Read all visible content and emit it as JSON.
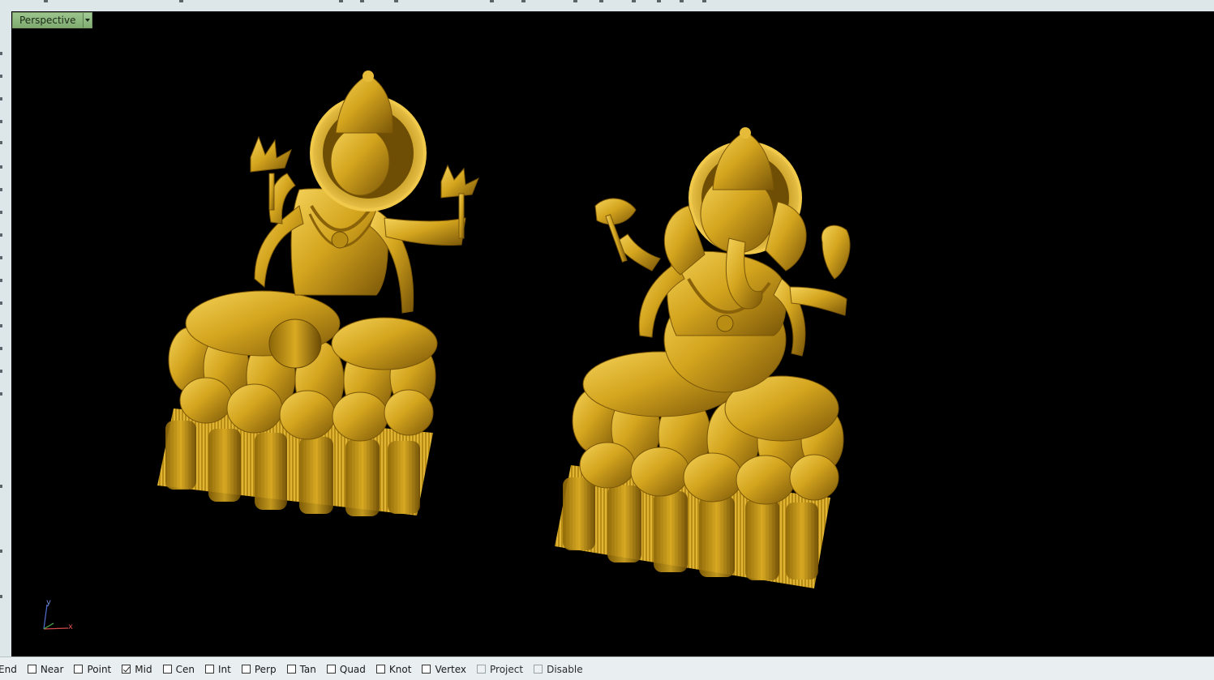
{
  "viewport": {
    "title": "Perspective",
    "axis": {
      "y": "y",
      "x": "x"
    }
  },
  "osnap": [
    {
      "label": "End",
      "checked": false,
      "show_box": false
    },
    {
      "label": "Near",
      "checked": false
    },
    {
      "label": "Point",
      "checked": false
    },
    {
      "label": "Mid",
      "checked": true
    },
    {
      "label": "Cen",
      "checked": false
    },
    {
      "label": "Int",
      "checked": false
    },
    {
      "label": "Perp",
      "checked": false
    },
    {
      "label": "Tan",
      "checked": false
    },
    {
      "label": "Quad",
      "checked": false
    },
    {
      "label": "Knot",
      "checked": false
    },
    {
      "label": "Vertex",
      "checked": false
    },
    {
      "label": "Project",
      "checked": false,
      "disabled": true
    },
    {
      "label": "Disable",
      "checked": false,
      "disabled": true
    }
  ],
  "colors": {
    "viewport_bg": "#000000",
    "model_gold": "#d4a51e",
    "tab_green": "#8ab77e"
  }
}
